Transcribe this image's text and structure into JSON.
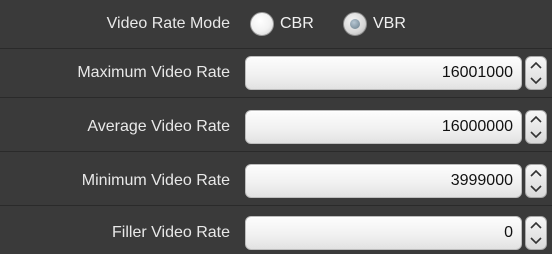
{
  "rate_mode": {
    "label": "Video Rate Mode",
    "options": [
      {
        "label": "CBR",
        "selected": false
      },
      {
        "label": "VBR",
        "selected": true
      }
    ]
  },
  "fields": [
    {
      "label": "Maximum Video Rate",
      "value": "16001000"
    },
    {
      "label": "Average Video Rate",
      "value": "16000000"
    },
    {
      "label": "Minimum Video Rate",
      "value": "3999000"
    },
    {
      "label": "Filler Video Rate",
      "value": "0"
    }
  ],
  "icons": {
    "spin_up": "chevron-up-icon",
    "spin_down": "chevron-down-icon"
  },
  "colors": {
    "panel_background": "#3a3a3a",
    "label_text": "#e8e8e8",
    "field_background": "#f1f1f1",
    "selected_radio_dot": "#7f929f"
  }
}
